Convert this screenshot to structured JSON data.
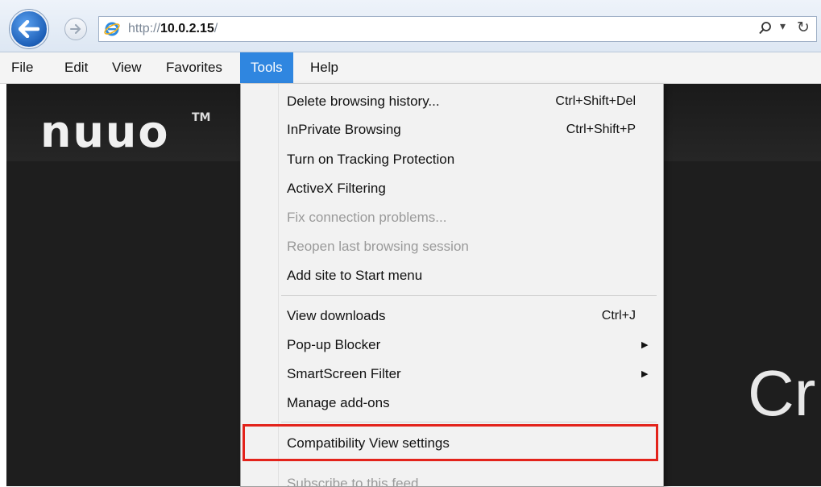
{
  "address_bar": {
    "url_prefix": "http://",
    "url_host": "10.0.2.15",
    "url_suffix": "/",
    "search_icon": "search-icon",
    "dropdown_icon": "dropdown-arrow-icon",
    "refresh_icon": "refresh-icon"
  },
  "menubar": {
    "items": [
      "File",
      "Edit",
      "View",
      "Favorites",
      "Tools",
      "Help"
    ],
    "active": "Tools",
    "active_color": "#2f86e0"
  },
  "page": {
    "logo": "nuuo",
    "logo_tm": "TM",
    "hero_text": "Cr"
  },
  "tools_menu": {
    "items": [
      {
        "label": "Delete browsing history...",
        "shortcut": "Ctrl+Shift+Del",
        "enabled": true
      },
      {
        "label": "InPrivate Browsing",
        "shortcut": "Ctrl+Shift+P",
        "enabled": true
      },
      {
        "label": "Turn on Tracking Protection",
        "enabled": true
      },
      {
        "label": "ActiveX Filtering",
        "enabled": true
      },
      {
        "label": "Fix connection problems...",
        "enabled": false
      },
      {
        "label": "Reopen last browsing session",
        "enabled": false
      },
      {
        "label": "Add site to Start menu",
        "enabled": true
      },
      {
        "label": "View downloads",
        "shortcut": "Ctrl+J",
        "enabled": true
      },
      {
        "label": "Pop-up Blocker",
        "submenu": true,
        "enabled": true
      },
      {
        "label": "SmartScreen Filter",
        "submenu": true,
        "enabled": true
      },
      {
        "label": "Manage add-ons",
        "enabled": true
      },
      {
        "label": "Compatibility View settings",
        "enabled": true,
        "highlighted": true
      },
      {
        "label": "Subscribe to this feed...",
        "enabled": false
      }
    ],
    "highlight_color": "#e3231b"
  }
}
